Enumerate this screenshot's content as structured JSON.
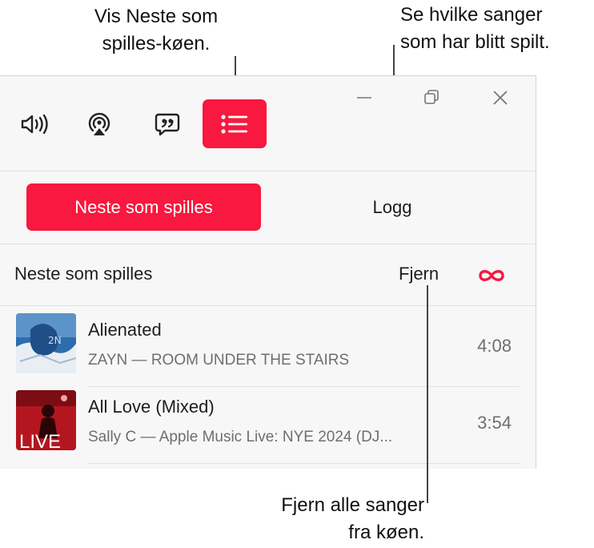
{
  "callouts": {
    "queue": "Vis Neste som\nspilles-køen.",
    "history": "Se hvilke sanger\nsom har blitt spilt.",
    "clear": "Fjern alle sanger\nfra køen."
  },
  "toolbar": {
    "volume_icon": "speaker-wave-icon",
    "airplay_icon": "airplay-icon",
    "lyrics_icon": "lyrics-quote-icon",
    "queue_icon": "list-bullet-icon"
  },
  "tabs": {
    "up_next": "Neste som spilles",
    "history": "Logg"
  },
  "queue": {
    "title": "Neste som spilles",
    "clear_label": "Fjern",
    "autoplay_icon": "infinity-icon",
    "items": [
      {
        "title": "Alienated",
        "subtitle": "ZAYN — ROOM UNDER THE STAIRS",
        "duration": "4:08"
      },
      {
        "title": "All Love (Mixed)",
        "subtitle": "Sally C — Apple Music Live: NYE 2024 (DJ...",
        "duration": "3:54",
        "art_text": "LIVE"
      }
    ]
  },
  "colors": {
    "accent": "#f9183f"
  }
}
